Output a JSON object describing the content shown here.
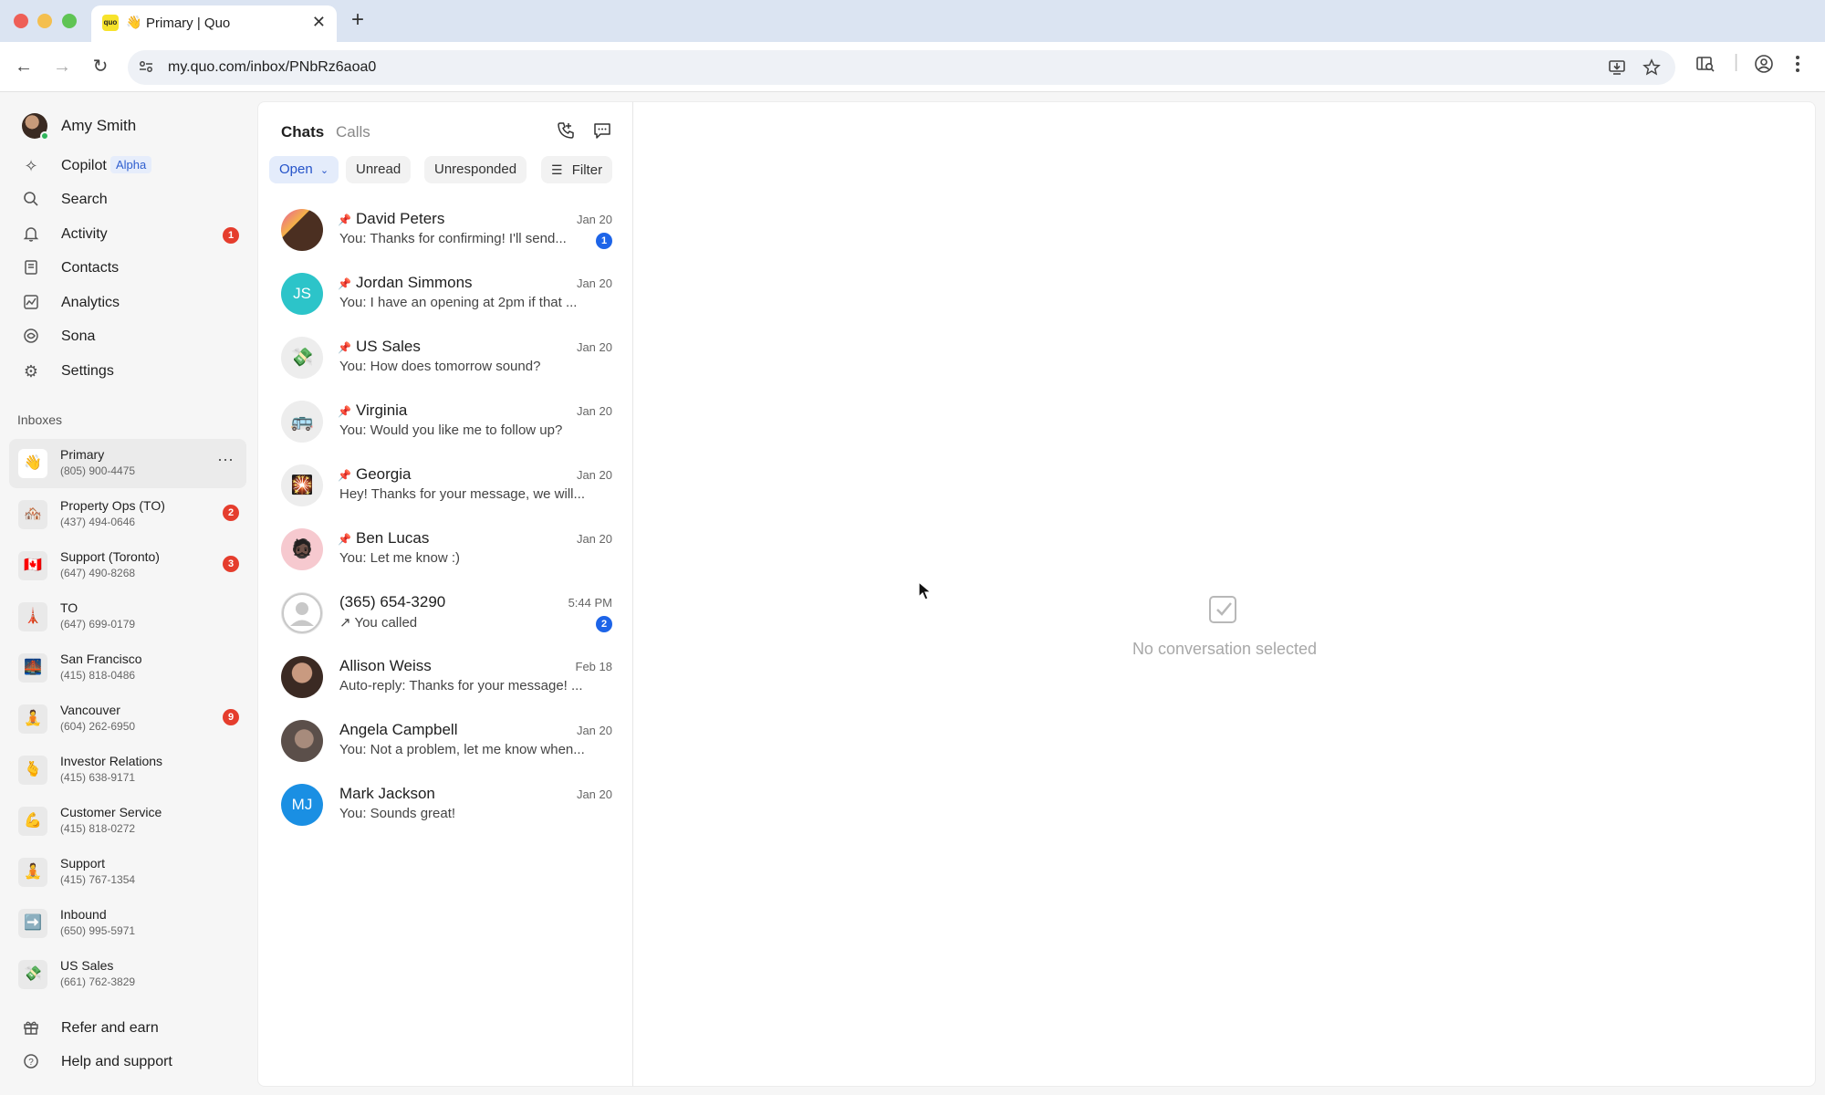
{
  "browser": {
    "tab": {
      "favicon_text": "quo",
      "emoji": "👋",
      "title": "Primary | Quo",
      "close_glyph": "✕"
    },
    "new_tab_glyph": "+",
    "url": "my.quo.com/inbox/PNbRz6aoa0",
    "nav": {
      "back": "←",
      "forward": "→",
      "reload": "↻"
    },
    "icons": [
      "site-settings-icon",
      "install-icon",
      "star-icon",
      "sidebar-search-icon",
      "profile-icon",
      "menu-icon"
    ]
  },
  "sidebar": {
    "user_name": "Amy Smith",
    "nav": [
      {
        "label": "Copilot",
        "badge_text": "Alpha",
        "icon": "sparkle-icon",
        "glyph": "✧"
      },
      {
        "label": "Search",
        "icon": "search-icon",
        "glyph": "⌕"
      },
      {
        "label": "Activity",
        "count": "1",
        "icon": "bell-icon",
        "glyph": "🔔"
      },
      {
        "label": "Contacts",
        "icon": "contacts-icon",
        "glyph": "▤"
      },
      {
        "label": "Analytics",
        "icon": "analytics-icon",
        "glyph": "⟋"
      },
      {
        "label": "Sona",
        "icon": "sona-icon",
        "glyph": "◎"
      },
      {
        "label": "Settings",
        "icon": "gear-icon",
        "glyph": "⚙"
      }
    ],
    "inboxes_heading": "Inboxes",
    "inboxes": [
      {
        "name": "Primary",
        "number": "(805) 900-4475",
        "emoji": "👋",
        "more": "···"
      },
      {
        "name": "Property Ops (TO)",
        "number": "(437) 494-0646",
        "emoji": "🏘️",
        "count": "2"
      },
      {
        "name": "Support (Toronto)",
        "number": "(647) 490-8268",
        "emoji": "🇨🇦",
        "count": "3"
      },
      {
        "name": "TO",
        "number": "(647) 699-0179",
        "emoji": "🗼"
      },
      {
        "name": "San Francisco",
        "number": "(415) 818-0486",
        "emoji": "🌉"
      },
      {
        "name": "Vancouver",
        "number": "(604) 262-6950",
        "emoji": "🧘",
        "count": "9"
      },
      {
        "name": "Investor Relations",
        "number": "(415) 638-9171",
        "emoji": "🫰"
      },
      {
        "name": "Customer Service",
        "number": "(415) 818-0272",
        "emoji": "💪"
      },
      {
        "name": "Support",
        "number": "(415) 767-1354",
        "emoji": "🧘"
      },
      {
        "name": "Inbound",
        "number": "(650) 995-5971",
        "emoji": "➡️"
      },
      {
        "name": "US Sales",
        "number": "(661) 762-3829",
        "emoji": "💸"
      }
    ],
    "footer": [
      {
        "label": "Refer and earn",
        "icon": "gift-icon",
        "glyph": "🎁"
      },
      {
        "label": "Help and support",
        "icon": "help-icon",
        "glyph": "?"
      }
    ]
  },
  "chats": {
    "tab_chats": "Chats",
    "tab_calls": "Calls",
    "filters": {
      "open": "Open",
      "unread": "Unread",
      "unresponded": "Unresponded",
      "filter": "Filter"
    },
    "conversations": [
      {
        "name": "David Peters",
        "preview": "You: Thanks for confirming! I'll send...",
        "date": "Jan 20",
        "pinned": true,
        "unread": "1",
        "avatar_kind": "photo",
        "avatar_color": "#8a5a3c"
      },
      {
        "name": "Jordan Simmons",
        "preview": "You: I have an opening at 2pm if that ...",
        "date": "Jan 20",
        "pinned": true,
        "initials": "JS",
        "avatar_color": "#2cc4c9"
      },
      {
        "name": "US Sales",
        "preview": "You: How does tomorrow sound?",
        "date": "Jan 20",
        "pinned": true,
        "emoji": "💸",
        "avatar_color": "#ededed"
      },
      {
        "name": "Virginia",
        "preview": "You: Would you like me to follow up?",
        "date": "Jan 20",
        "pinned": true,
        "emoji": "🚌",
        "avatar_color": "#ededed"
      },
      {
        "name": "Georgia",
        "preview": "Hey! Thanks for your message, we will...",
        "date": "Jan 20",
        "pinned": true,
        "emoji": "🎇",
        "avatar_color": "#ededed"
      },
      {
        "name": "Ben Lucas",
        "preview": "You: Let me know :)",
        "date": "Jan 20",
        "pinned": true,
        "emoji": "🧔🏿",
        "avatar_color": "#f6c9cf"
      },
      {
        "name": "(365) 654-3290",
        "preview": "↗ You called",
        "date": "5:44 PM",
        "pinned": false,
        "unread": "2",
        "avatar_kind": "placeholder",
        "avatar_color": "#e4e4e4"
      },
      {
        "name": "Allison Weiss",
        "preview": "Auto-reply: Thanks for your message! ...",
        "date": "Feb 18",
        "pinned": false,
        "avatar_kind": "photo",
        "avatar_color": "#4a3a33"
      },
      {
        "name": "Angela Campbell",
        "preview": "You: Not a problem, let me know when...",
        "date": "Jan 20",
        "pinned": false,
        "avatar_kind": "photo",
        "avatar_color": "#6b5f5a"
      },
      {
        "name": "Mark Jackson",
        "preview": "You: Sounds great!",
        "date": "Jan 20",
        "pinned": false,
        "initials": "MJ",
        "avatar_color": "#1a8fe3"
      }
    ]
  },
  "main": {
    "empty_text": "No conversation selected"
  }
}
